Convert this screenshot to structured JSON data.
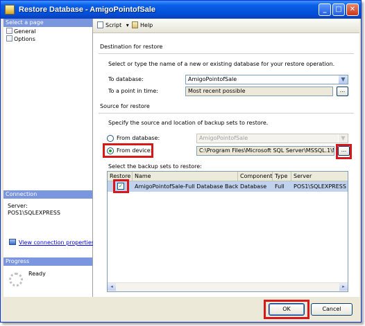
{
  "window": {
    "title": "Restore Database - AmigoPointofSale"
  },
  "title_buttons": {
    "minimize": "_",
    "maximize": "□",
    "close": "✕"
  },
  "left_pane": {
    "select_page_header": "Select a page",
    "pages": [
      {
        "label": "General",
        "icon": "page-icon"
      },
      {
        "label": "Options",
        "icon": "page-icon"
      }
    ],
    "connection_header": "Connection",
    "server_label": "Server:",
    "server_value": "POS1\\SQLEXPRESS",
    "view_connection_link": "View connection properties",
    "progress_header": "Progress",
    "progress_status": "Ready"
  },
  "toolbar": {
    "script_label": "Script",
    "script_arrow": "▾",
    "help_label": "Help"
  },
  "destination": {
    "section_title": "Destination for restore",
    "instruction": "Select or type the name of a new or existing database for your restore operation.",
    "to_database_label": "To database:",
    "to_database_value": "AmigoPointofSale",
    "point_in_time_label": "To a point in time:",
    "point_in_time_value": "Most recent possible",
    "ellipsis": "..."
  },
  "source": {
    "section_title": "Source for restore",
    "instruction": "Specify the source and location of backup sets to restore.",
    "from_database_label": "From database:",
    "from_database_value": "AmigoPointofSale",
    "from_device_label": "From device:",
    "from_device_value": "C:\\Program Files\\Microsoft SQL Server\\MSSQL.1\\MSSQL",
    "ellipsis": "...",
    "selected_option": "from_device"
  },
  "backup_sets": {
    "label": "Select the backup sets to restore:",
    "columns": [
      "Restore",
      "Name",
      "Component",
      "Type",
      "Server"
    ],
    "rows": [
      {
        "restore": true,
        "name": "AmigoPointofSale-Full Database Backup",
        "component": "Database",
        "type": "Full",
        "server": "POS1\\SQLEXPRESS"
      }
    ],
    "scroll_left": "◂",
    "scroll_right": "▸"
  },
  "footer": {
    "ok_label": "OK",
    "cancel_label": "Cancel"
  },
  "highlight_color": "#d81818"
}
